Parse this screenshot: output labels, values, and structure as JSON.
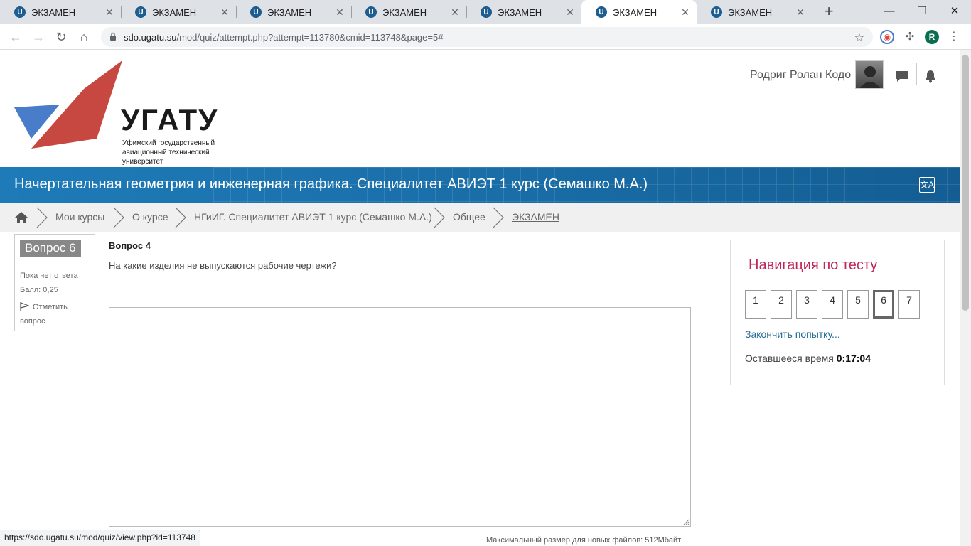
{
  "browser": {
    "tabs": [
      {
        "label": "ЭКЗАМЕН"
      },
      {
        "label": "ЭКЗАМЕН"
      },
      {
        "label": "ЭКЗАМЕН"
      },
      {
        "label": "ЭКЗАМЕН"
      },
      {
        "label": "ЭКЗАМЕН"
      },
      {
        "label": "ЭКЗАМЕН"
      },
      {
        "label": "ЭКЗАМЕН"
      }
    ],
    "active_tab_index": 5,
    "url_host": "sdo.ugatu.su",
    "url_path": "/mod/quiz/attempt.php?attempt=113780&cmid=113748&page=5#",
    "profile_initial": "R",
    "status_url": "https://sdo.ugatu.su/mod/quiz/view.php?id=113748"
  },
  "header": {
    "logo_text": "УГАТУ",
    "logo_subtitle_1": "Уфимский государственный",
    "logo_subtitle_2": "авиационный технический",
    "logo_subtitle_3": "университет",
    "user_name": "Родриг Ролан Кодо"
  },
  "banner": {
    "course_title": "Начертательная геометрия и инженерная графика. Специалитет АВИЭТ 1 курс (Семашко М.А.)"
  },
  "breadcrumb": [
    {
      "label": "Мои курсы"
    },
    {
      "label": "О курсе"
    },
    {
      "label": "НГиИГ. Специалитет АВИЭТ 1 курс (Семашко М.А.)"
    },
    {
      "label": "Общее"
    },
    {
      "label": "ЭКЗАМЕН"
    }
  ],
  "question_info": {
    "number_label": "Вопрос 6",
    "state": "Пока нет ответа",
    "grade": "Балл: 0,25",
    "flag_label": "Отметить вопрос"
  },
  "question": {
    "title": "Вопрос 4",
    "text": "На какие изделия не выпускаются рабочие чертежи?",
    "max_file_size": "Максимальный размер для новых файлов: 512Мбайт"
  },
  "quiz_nav": {
    "heading": "Навигация по тесту",
    "buttons": [
      "1",
      "2",
      "3",
      "4",
      "5",
      "6",
      "7"
    ],
    "current": "6",
    "finish_label": "Закончить попытку...",
    "time_label": "Оставшееся время",
    "time_value": "0:17:04"
  },
  "colors": {
    "banner": "#1a6ea8",
    "nav_heading": "#c0265a",
    "logo_red": "#c74840",
    "logo_blue": "#4a7dc9"
  }
}
